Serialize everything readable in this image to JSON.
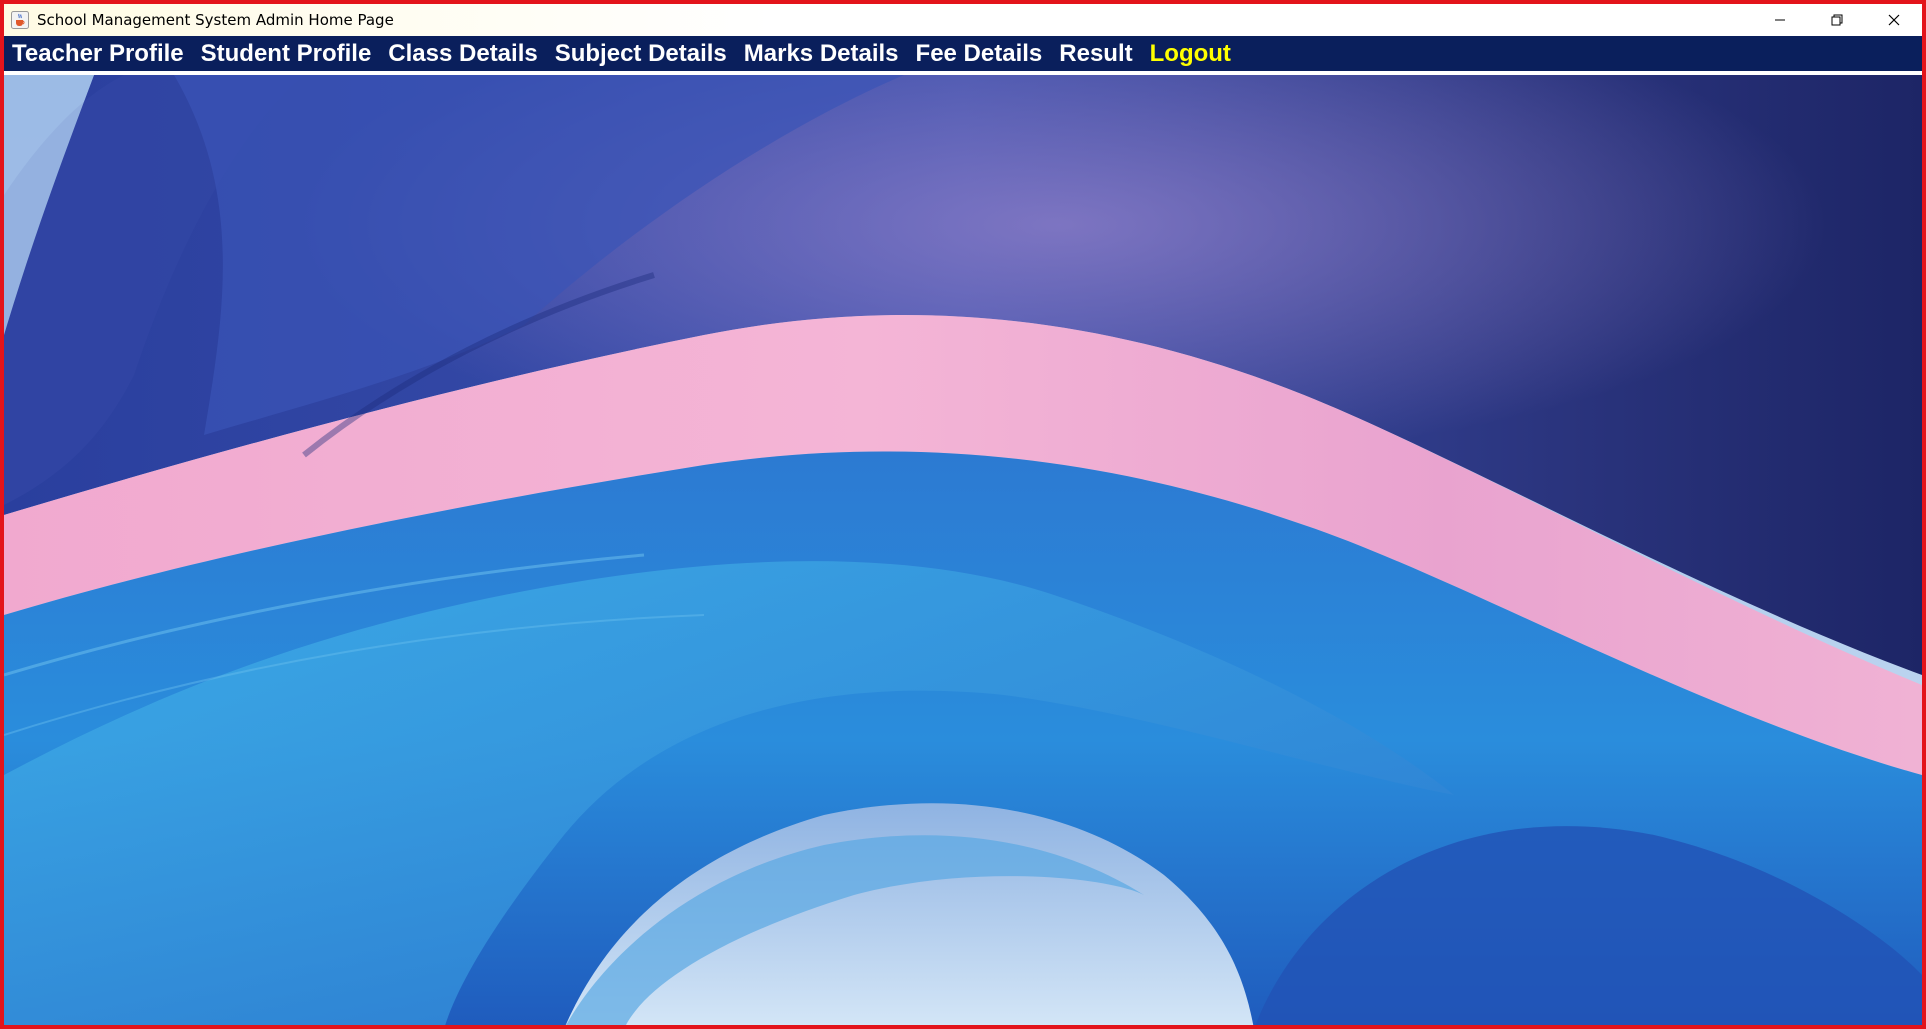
{
  "window": {
    "title": "School Management System Admin Home Page",
    "icon": "java-cup-icon",
    "controls": [
      "minimize-icon",
      "restore-icon",
      "close-icon"
    ],
    "border_color": "#e3141b"
  },
  "menubar": {
    "background": "#0a1f5c",
    "items": [
      {
        "label": "Teacher Profile"
      },
      {
        "label": "Student Profile"
      },
      {
        "label": "Class Details"
      },
      {
        "label": "Subject Details"
      },
      {
        "label": "Marks Details"
      },
      {
        "label": "Fee Details"
      },
      {
        "label": "Result"
      }
    ],
    "logout_label": "Logout",
    "logout_color": "#ffff00"
  },
  "background": {
    "description_icon": "abstract-blue-silk-wallpaper",
    "colors": [
      "#1e2a78",
      "#2f56b8",
      "#3fa2e0",
      "#e7a8d0",
      "#c6dcf2"
    ]
  }
}
